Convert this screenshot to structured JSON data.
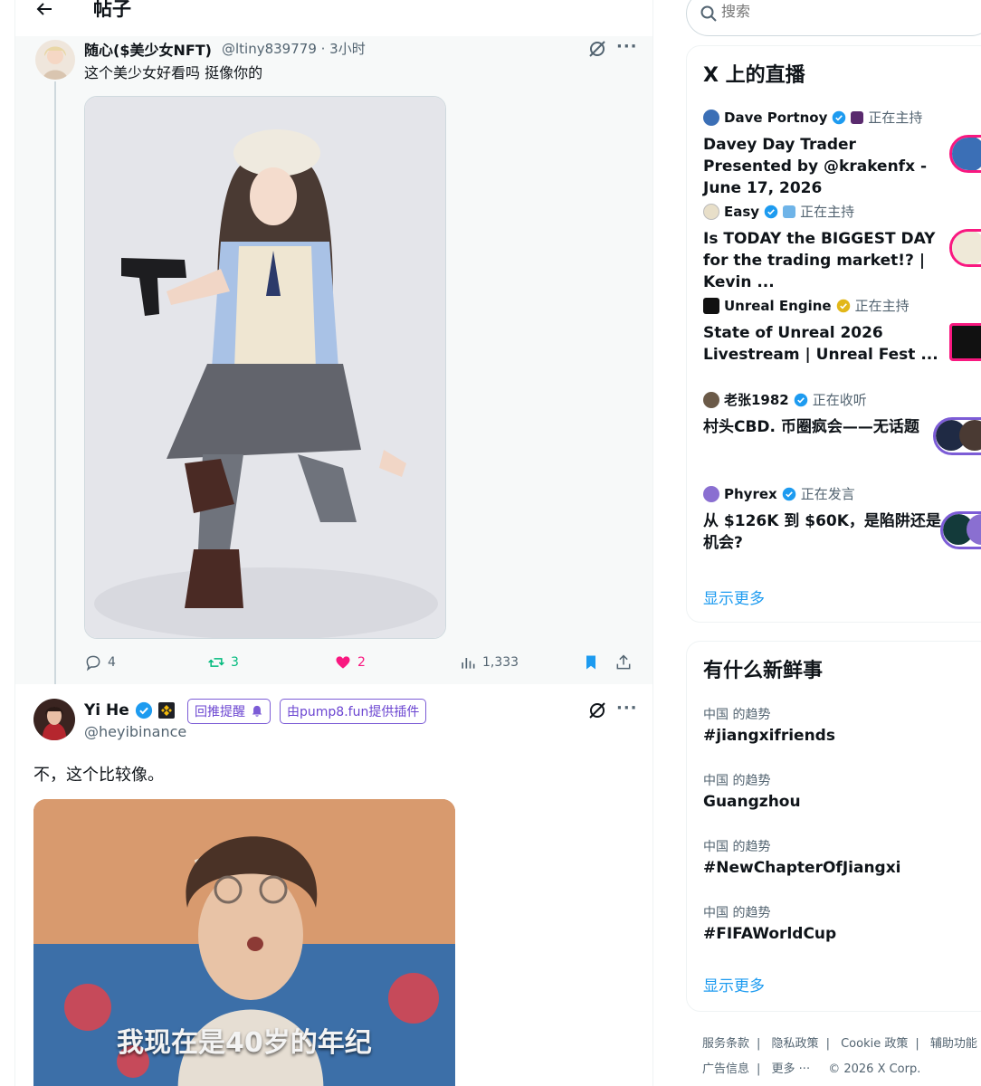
{
  "header": {
    "title": "帖子"
  },
  "post1": {
    "name": "随心($美少女NFT)",
    "handle": "@ltiny839779 · 3小时",
    "text": "这个美少女好看吗 挺像你的",
    "stats": {
      "replies": "4",
      "reposts": "3",
      "likes": "2",
      "views": "1,333"
    }
  },
  "post2": {
    "name": "Yi He",
    "handle": "@heyibinance",
    "plugin_remind": "回推提醒",
    "plugin_provider": "由pump8.fun提供插件",
    "text": "不，这个比较像。",
    "image_caption": "我现在是40岁的年纪"
  },
  "search": {
    "placeholder": "搜索"
  },
  "live": {
    "title": "X 上的直播",
    "items": [
      {
        "host": "Dave Portnoy",
        "status": "正在主持",
        "title": "Davey Day Trader Presented by @krakenfx - June 17, 2026",
        "avatar_color": "#3b6fb6"
      },
      {
        "host": "Easy",
        "status": "正在主持",
        "title": "Is TODAY the BIGGEST DAY for the trading market!? | Kevin ...",
        "avatar_color": "#e8dfc9"
      },
      {
        "host": "Unreal Engine",
        "status": "正在主持",
        "title": "State of Unreal 2026 Livestream | Unreal Fest ...",
        "avatar_color": "#111111"
      },
      {
        "host": "老张1982",
        "status": "正在收听",
        "title": "村头CBD. 币圈疯会——无话题",
        "avatar_color": "#6b5a48"
      },
      {
        "host": "Phyrex",
        "status": "正在发言",
        "title": "从 $126K 到 $60K，是陷阱还是机会?",
        "avatar_color": "#8a6fd1"
      }
    ],
    "show_more": "显示更多"
  },
  "trends": {
    "title": "有什么新鲜事",
    "items": [
      {
        "context": "中国 的趋势",
        "name": "#jiangxifriends"
      },
      {
        "context": "中国 的趋势",
        "name": "Guangzhou"
      },
      {
        "context": "中国 的趋势",
        "name": "#NewChapterOfJiangxi"
      },
      {
        "context": "中国 的趋势",
        "name": "#FIFAWorldCup"
      }
    ],
    "show_more": "显示更多"
  },
  "footer": {
    "terms": "服务条款",
    "privacy": "隐私政策",
    "cookie": "Cookie 政策",
    "accessibility": "辅助功能",
    "ads": "广告信息",
    "more": "更多 ···",
    "copyright": "© 2026 X Corp."
  }
}
